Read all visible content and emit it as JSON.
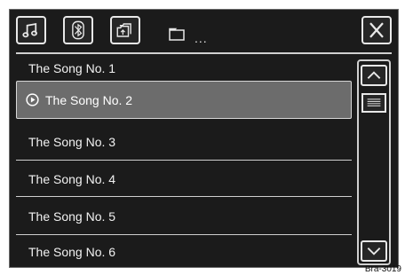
{
  "path": {
    "folder_icon": "folder-icon",
    "ellipsis": "..."
  },
  "top_buttons": [
    {
      "name": "music-source-button",
      "icon": "music-note-icon"
    },
    {
      "name": "bluetooth-button",
      "icon": "bluetooth-icon"
    },
    {
      "name": "folder-up-button",
      "icon": "folder-up-icon"
    }
  ],
  "close_button": {
    "icon": "close-icon"
  },
  "songs": [
    {
      "title": "The Song No. 1",
      "playing": false
    },
    {
      "title": "The Song No. 2",
      "playing": true
    },
    {
      "title": "The Song No. 3",
      "playing": false
    },
    {
      "title": "The Song No. 4",
      "playing": false
    },
    {
      "title": "The Song No. 5",
      "playing": false
    },
    {
      "title": "The Song No. 6",
      "playing": false
    }
  ],
  "scrollbar": {
    "up_icon": "chevron-up-icon",
    "down_icon": "chevron-down-icon",
    "thumb_icon": "scroll-thumb-icon"
  },
  "reference_label": "Bra-3019",
  "colors": {
    "screen_bg": "#1b1b1b",
    "selected_row_bg": "#6c6c6c",
    "foreground": "#e8e8e8"
  }
}
